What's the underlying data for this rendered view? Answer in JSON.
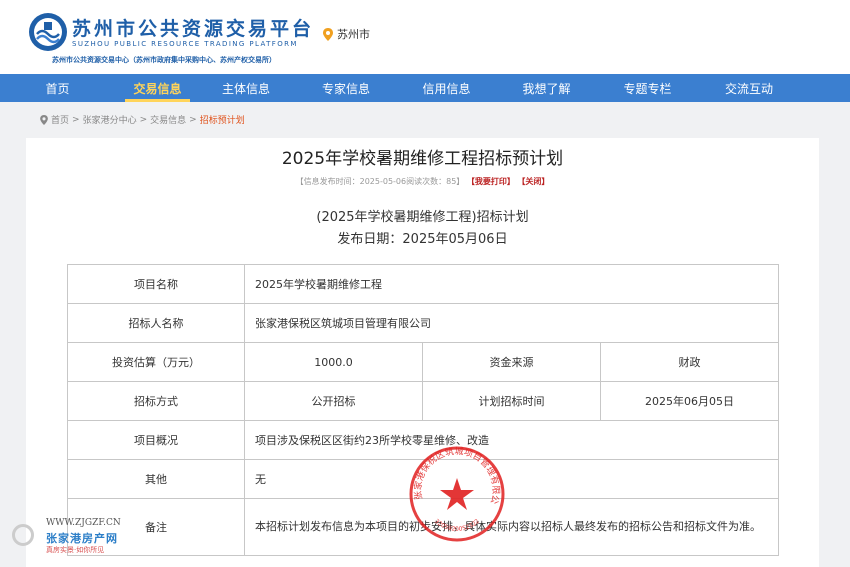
{
  "header": {
    "logo_cn": "苏州市公共资源交易平台",
    "logo_en": "SUZHOU PUBLIC RESOURCE TRADING PLATFORM",
    "logo_sub": "苏州市公共资源交易中心（苏州市政府集中采购中心、苏州产权交易所）",
    "location": "苏州市"
  },
  "nav": {
    "items": [
      "首页",
      "交易信息",
      "主体信息",
      "专家信息",
      "信用信息",
      "我想了解",
      "专题专栏",
      "交流互动"
    ],
    "active_index": 1
  },
  "breadcrumb": [
    "首页",
    "张家港分中心",
    "交易信息",
    "招标预计划"
  ],
  "article": {
    "title": "2025年学校暑期维修工程招标预计划",
    "meta_prefix": "【信息发布时间：2025-05-06阅读次数：85】",
    "print_label": "【我要打印】",
    "close_label": "【关闭】",
    "subtitle": "(2025年学校暑期维修工程)招标计划",
    "publish_date": "发布日期：2025年05月06日"
  },
  "table": {
    "project_name_label": "项目名称",
    "project_name": "2025年学校暑期维修工程",
    "tenderer_label": "招标人名称",
    "tenderer": "张家港保税区筑城项目管理有限公司",
    "investment_label": "投资估算（万元）",
    "investment": "1000.0",
    "fund_source_label": "资金来源",
    "fund_source": "财政",
    "method_label": "招标方式",
    "method": "公开招标",
    "plan_time_label": "计划招标时间",
    "plan_time": "2025年06月05日",
    "overview_label": "项目概况",
    "overview": "项目涉及保税区区街约23所学校零星维修、改造",
    "other_label": "其他",
    "other": "无",
    "remark_label": "备注",
    "remark": "本招标计划发布信息为本项目的初步安排，具体实际内容以招标人最终发布的招标公告和招标文件为准。"
  },
  "seal": {
    "text": "张家港保税区筑城项目管理有限公司",
    "number": "3205920052322"
  },
  "watermark": {
    "url": "WWW.ZJGZF.CN",
    "name": "张家港房产网",
    "slogan": "真房实景·如你所见"
  }
}
